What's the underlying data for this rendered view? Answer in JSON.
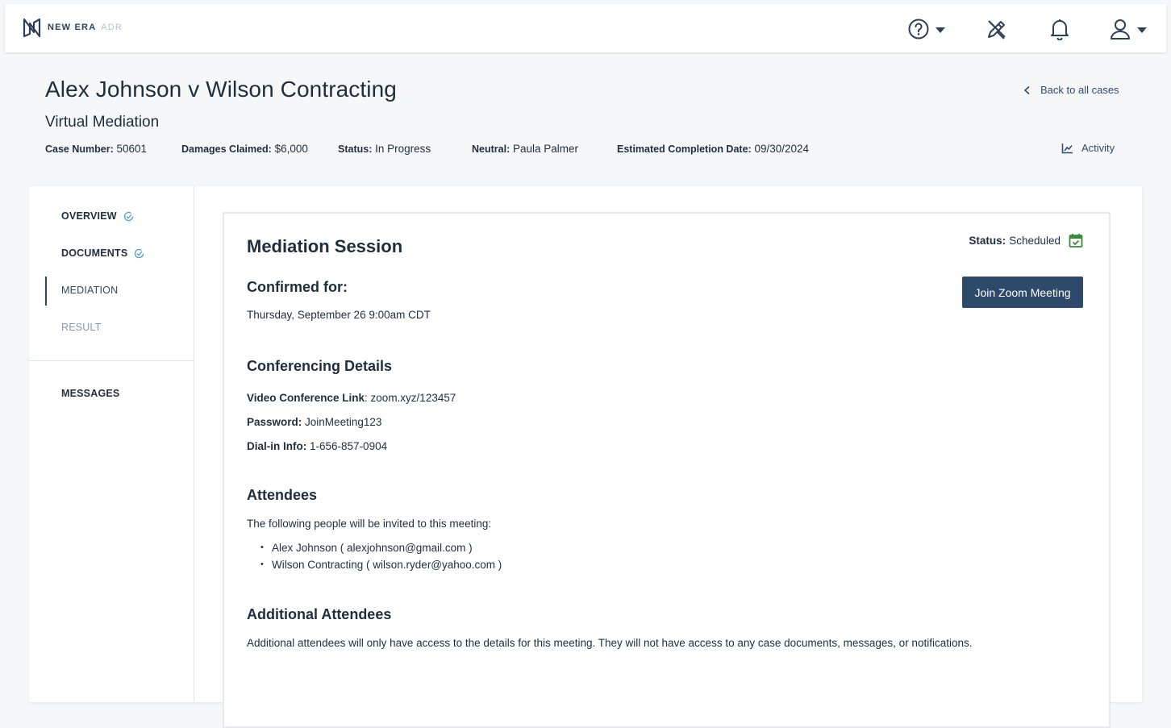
{
  "app": {
    "logo_text": "NEW ERA",
    "logo_suffix": "ADR",
    "nav_icons": [
      "help-icon",
      "edit-icon",
      "bell-icon",
      "user-icon"
    ]
  },
  "case": {
    "title": "Alex Johnson v Wilson Contracting",
    "subtitle": "Virtual Mediation",
    "meta": {
      "case_number_label": "Case Number:",
      "case_number": "50601",
      "damages_label": "Damages Claimed:",
      "damages": "$6,000",
      "status_label": "Status:",
      "status": "In Progress",
      "neutral_label": "Neutral:",
      "neutral": "Paula Palmer",
      "completion_label": "Estimated Completion Date:",
      "completion": "09/30/2024"
    },
    "back_link": "Back to all cases",
    "activity_link": "Activity"
  },
  "sidebar": {
    "items": [
      {
        "label": "OVERVIEW",
        "state": "complete"
      },
      {
        "label": "DOCUMENTS",
        "state": "complete"
      },
      {
        "label": "MEDIATION",
        "state": "active"
      },
      {
        "label": "RESULT",
        "state": "disabled"
      }
    ],
    "messages": "MESSAGES"
  },
  "session": {
    "title": "Mediation Session",
    "status_label": "Status:",
    "status": "Scheduled",
    "join_button": "Join Zoom Meeting",
    "confirmed_heading": "Confirmed for:",
    "confirmed_datetime": "Thursday, September 26 9:00am CDT",
    "conf_heading": "Conferencing Details",
    "video_label": "Video Conference Link",
    "video_value": ": zoom.xyz/123457",
    "password_label": "Password:",
    "password_value": "JoinMeeting123",
    "dialin_label": "Dial-in Info:",
    "dialin_value": "1-656-857-0904",
    "attendees_heading": "Attendees",
    "attendees_intro": "The following people will be invited to this meeting:",
    "attendees": [
      "Alex Johnson ( alexjohnson@gmail.com )",
      "Wilson Contracting ( wilson.ryder@yahoo.com )"
    ],
    "additional_heading": "Additional Attendees",
    "additional_text": "Additional attendees will only have access to the details for this meeting. They will not have access to any case documents, messages, or notifications."
  },
  "colors": {
    "primary": "#2e4a6b",
    "success": "#3a8a3a",
    "check": "#4a9bd6"
  }
}
